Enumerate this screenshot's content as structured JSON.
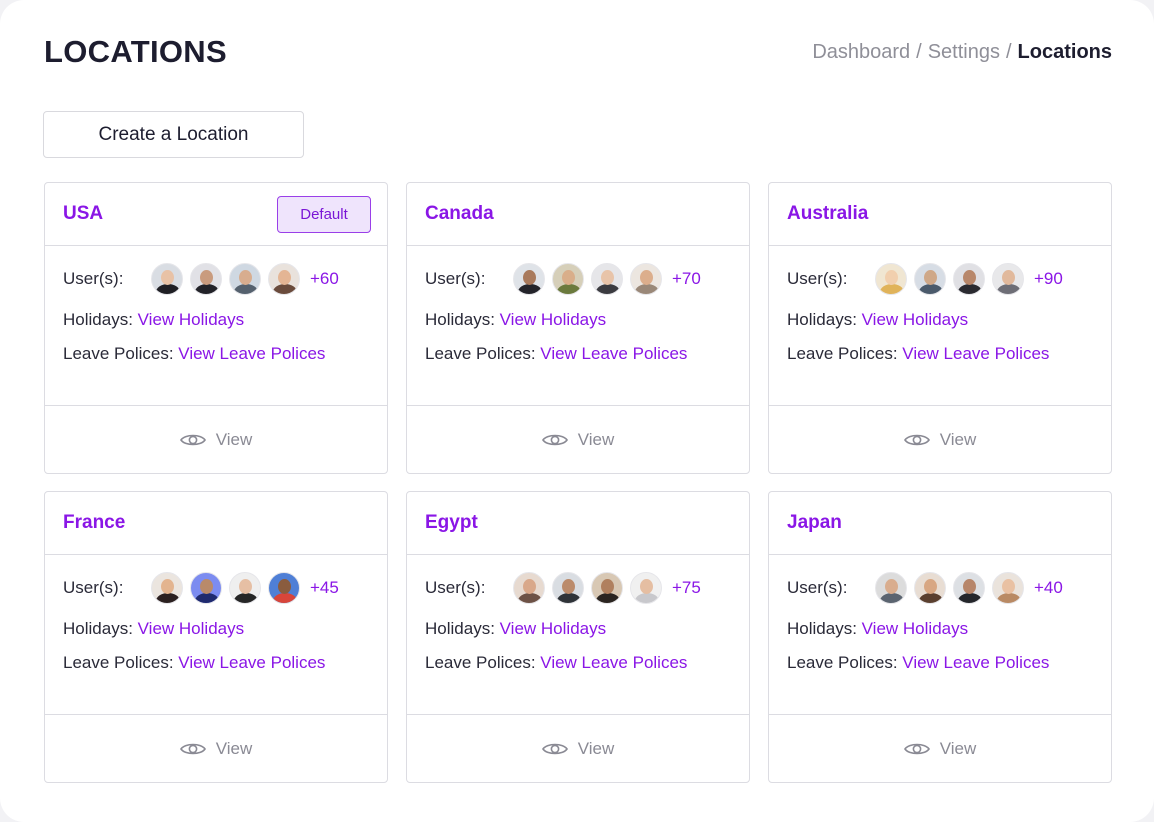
{
  "page": {
    "title": "LOCATIONS",
    "breadcrumb": [
      "Dashboard",
      "Settings",
      "Locations"
    ],
    "create_button": "Create a Location"
  },
  "colors": {
    "accent": "#8a16e6",
    "badge_bg": "#efe4fc",
    "muted": "#8a8a94",
    "title": "#1d1d2f"
  },
  "labels": {
    "users": "User(s):",
    "holidays": "Holidays:",
    "holidays_link": "View Holidays",
    "leave": "Leave Polices:",
    "leave_link": "View Leave Polices",
    "view": "View",
    "default": "Default"
  },
  "locations": [
    {
      "name": "USA",
      "default": true,
      "more": "+60",
      "avatars": [
        {
          "bg": "#d9dde3",
          "skin": "#e8c2a6",
          "shirt": "#1f1f24"
        },
        {
          "bg": "#e1e1e6",
          "skin": "#c99b7e",
          "shirt": "#222228"
        },
        {
          "bg": "#cfd8e2",
          "skin": "#d8ad8f",
          "shirt": "#55616e"
        },
        {
          "bg": "#e9e2dc",
          "skin": "#e4b594",
          "shirt": "#6a4b3c"
        }
      ]
    },
    {
      "name": "Canada",
      "default": false,
      "more": "+70",
      "avatars": [
        {
          "bg": "#dfe3e8",
          "skin": "#a97a5c",
          "shirt": "#24242a"
        },
        {
          "bg": "#d6cfb9",
          "skin": "#d9ae8a",
          "shirt": "#6b7a3d"
        },
        {
          "bg": "#e6e6e9",
          "skin": "#e8c4a9",
          "shirt": "#3b3b40"
        },
        {
          "bg": "#ece6e0",
          "skin": "#dcae8c",
          "shirt": "#9a8878"
        }
      ]
    },
    {
      "name": "Australia",
      "default": false,
      "more": "+90",
      "avatars": [
        {
          "bg": "#f0e6d2",
          "skin": "#f1cfae",
          "shirt": "#e0b35a"
        },
        {
          "bg": "#d7dde5",
          "skin": "#cfa888",
          "shirt": "#4b5a6b"
        },
        {
          "bg": "#e0e0e4",
          "skin": "#b8876a",
          "shirt": "#2a2a30"
        },
        {
          "bg": "#e8e8ea",
          "skin": "#e1b99c",
          "shirt": "#6e6e76"
        }
      ]
    },
    {
      "name": "France",
      "default": false,
      "more": "+45",
      "avatars": [
        {
          "bg": "#ebe5df",
          "skin": "#e3b48f",
          "shirt": "#2b2020"
        },
        {
          "bg": "#7c8cf0",
          "skin": "#b98a6a",
          "shirt": "#1f2a6e"
        },
        {
          "bg": "#efefef",
          "skin": "#e6bfa4",
          "shirt": "#262626"
        },
        {
          "bg": "#4f7fd6",
          "skin": "#8a5c3e",
          "shirt": "#d8453a"
        }
      ]
    },
    {
      "name": "Egypt",
      "default": false,
      "more": "+75",
      "avatars": [
        {
          "bg": "#e7dad0",
          "skin": "#d9a88a",
          "shirt": "#6d5246"
        },
        {
          "bg": "#d9dde2",
          "skin": "#bb8b6b",
          "shirt": "#2f3338"
        },
        {
          "bg": "#d8c8b4",
          "skin": "#b0805e",
          "shirt": "#2a2420"
        },
        {
          "bg": "#f0f0f0",
          "skin": "#e5bea2",
          "shirt": "#c8c8cc"
        }
      ]
    },
    {
      "name": "Japan",
      "default": false,
      "more": "+40",
      "avatars": [
        {
          "bg": "#dcdcdc",
          "skin": "#d9ad8e",
          "shirt": "#5b6470"
        },
        {
          "bg": "#e8ddd3",
          "skin": "#d8a783",
          "shirt": "#5a3f2f"
        },
        {
          "bg": "#dde0e4",
          "skin": "#b7866a",
          "shirt": "#24262b"
        },
        {
          "bg": "#eae3dc",
          "skin": "#e9c1a3",
          "shirt": "#b98a64"
        }
      ]
    }
  ]
}
